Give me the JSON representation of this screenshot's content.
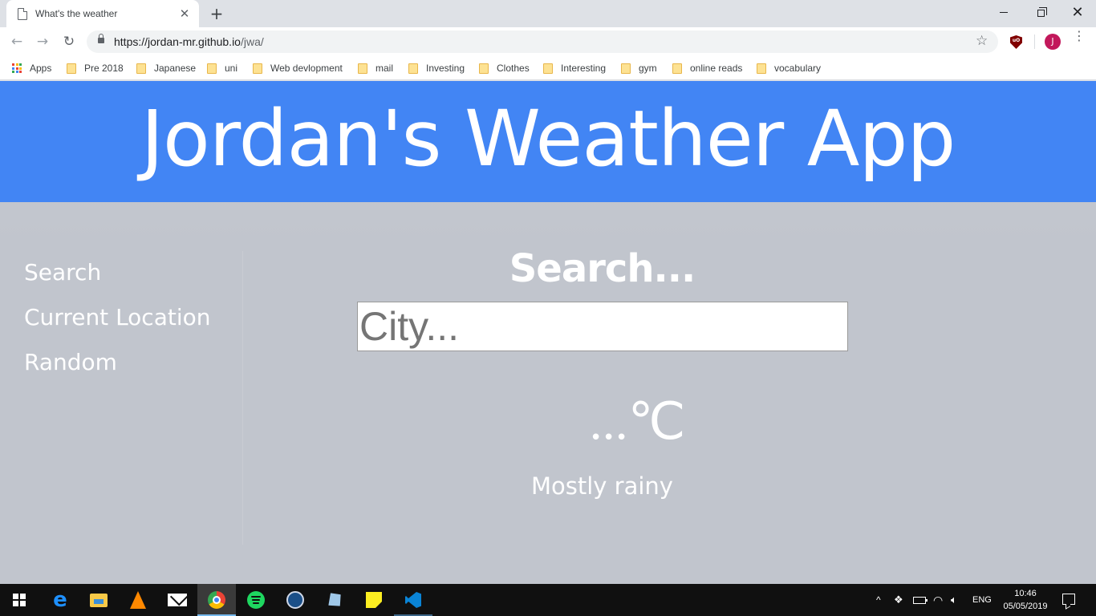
{
  "browser": {
    "tab": {
      "title": "What's the weather",
      "close_glyph": "✕"
    },
    "new_tab_glyph": "+",
    "window": {
      "minimize_glyph": "",
      "close_glyph": "✕"
    },
    "nav": {
      "back_glyph": "←",
      "forward_glyph": "→",
      "reload_glyph": "↻"
    },
    "address": {
      "url_main": "https://jordan-mr.github.io",
      "url_path": "/jwa/"
    },
    "star_glyph": "☆",
    "extension_label": "uO",
    "profile_initial": "J",
    "menu_glyph": "⋮",
    "bookmarks": [
      {
        "label": "Apps",
        "icon": "apps-grid-icon"
      },
      {
        "label": "Pre 2018",
        "icon": "folder-icon"
      },
      {
        "label": "Japanese",
        "icon": "folder-icon"
      },
      {
        "label": "uni",
        "icon": "folder-icon"
      },
      {
        "label": "Web devlopment",
        "icon": "folder-icon"
      },
      {
        "label": "mail",
        "icon": "folder-icon"
      },
      {
        "label": "Investing",
        "icon": "folder-icon"
      },
      {
        "label": "Clothes",
        "icon": "folder-icon"
      },
      {
        "label": "Interesting",
        "icon": "folder-icon"
      },
      {
        "label": "gym",
        "icon": "folder-icon"
      },
      {
        "label": "online reads",
        "icon": "folder-icon"
      },
      {
        "label": "vocabulary",
        "icon": "folder-icon"
      }
    ]
  },
  "app": {
    "title": "Jordan's Weather App",
    "nav": {
      "items": [
        {
          "label": "Search"
        },
        {
          "label": "Current Location"
        },
        {
          "label": "Random"
        }
      ]
    },
    "search": {
      "heading": "Search...",
      "placeholder": "City...",
      "value": ""
    },
    "weather": {
      "temperature": "...℃",
      "condition": "Mostly rainy"
    }
  },
  "taskbar": {
    "apps": [
      {
        "name": "start"
      },
      {
        "name": "edge"
      },
      {
        "name": "file-explorer"
      },
      {
        "name": "vlc"
      },
      {
        "name": "mail"
      },
      {
        "name": "chrome",
        "active": true
      },
      {
        "name": "spotify"
      },
      {
        "name": "steam"
      },
      {
        "name": "paint"
      },
      {
        "name": "sticky-notes"
      },
      {
        "name": "vscode"
      }
    ],
    "tray": {
      "chevron_glyph": "^",
      "language": "ENG",
      "time": "10:46",
      "date": "05/05/2019"
    }
  },
  "colors": {
    "header_blue": "#4285f4",
    "page_grey": "#c1c5cd",
    "text_white": "#ffffff",
    "taskbar": "#101010"
  }
}
